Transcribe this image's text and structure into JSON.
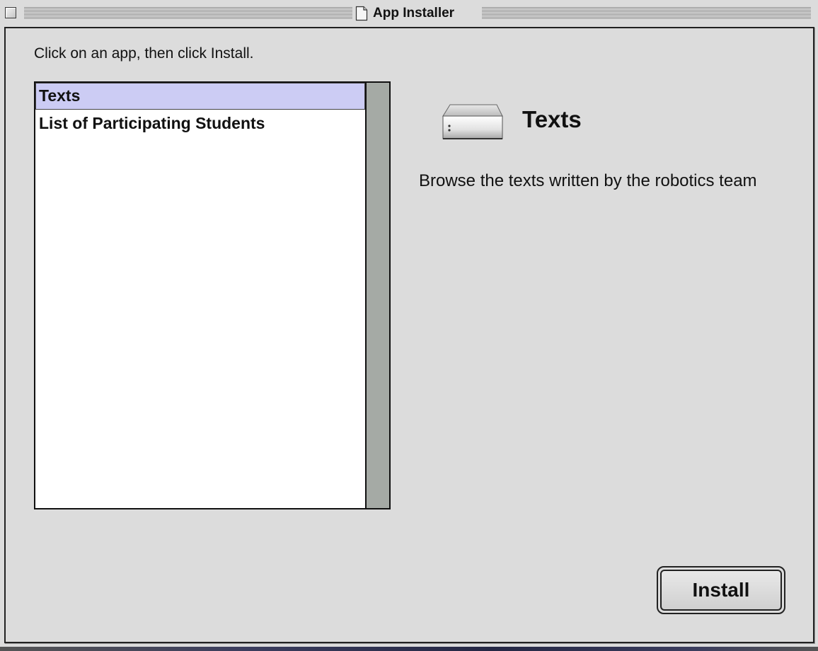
{
  "window": {
    "title": "App Installer"
  },
  "instructions": "Click on an app, then click Install.",
  "apps": [
    {
      "label": "Texts",
      "selected": true
    },
    {
      "label": "List of Participating Students",
      "selected": false
    }
  ],
  "detail": {
    "icon": "hard-drive-icon",
    "title": "Texts",
    "description": "Browse the texts written by the robotics team"
  },
  "buttons": {
    "install_label": "Install"
  },
  "colors": {
    "selection_highlight": "#ccccf4",
    "window_background": "#dcdcdc",
    "scrollbar_track": "#a5aaa5"
  }
}
